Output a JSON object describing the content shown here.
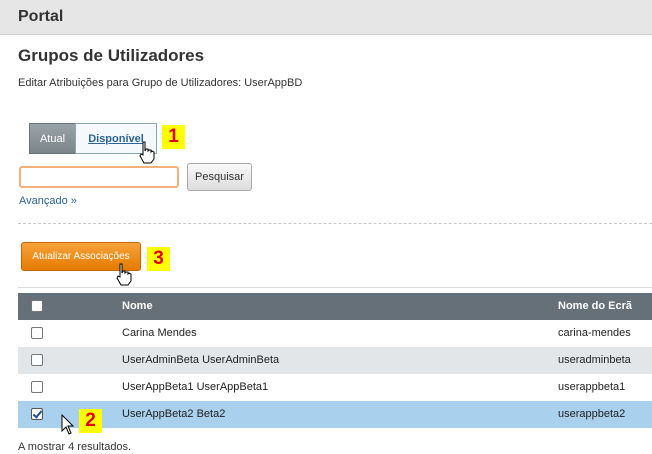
{
  "header": {
    "title": "Portal"
  },
  "page": {
    "title": "Grupos de Utilizadores",
    "subtitle": "Editar Atribuições para Grupo de Utilizadores: UserAppBD"
  },
  "tabs": [
    {
      "label": "Atual",
      "active": false
    },
    {
      "label": "Disponível",
      "active": true
    }
  ],
  "search": {
    "value": "",
    "placeholder": "",
    "button_label": "Pesquisar"
  },
  "advanced_link": "Avançado »",
  "update_button": "Atualizar Associações",
  "markers": [
    "1",
    "2",
    "3"
  ],
  "table": {
    "columns": [
      "Nome",
      "Nome do Ecrã"
    ],
    "rows": [
      {
        "name": "Carina Mendes",
        "screen_name": "carina-mendes",
        "checked": false
      },
      {
        "name": "UserAdminBeta UserAdminBeta",
        "screen_name": "useradminbeta",
        "checked": false
      },
      {
        "name": "UserAppBeta1 UserAppBeta1",
        "screen_name": "userappbeta1",
        "checked": false
      },
      {
        "name": "UserAppBeta2 Beta2",
        "screen_name": "userappbeta2",
        "checked": true
      }
    ]
  },
  "results_text": "A mostrar 4 resultados.",
  "colors": {
    "accent_orange": "#e57b00",
    "link": "#2a6496",
    "table_header": "#657078",
    "selected_row": "#a9d0ec"
  }
}
